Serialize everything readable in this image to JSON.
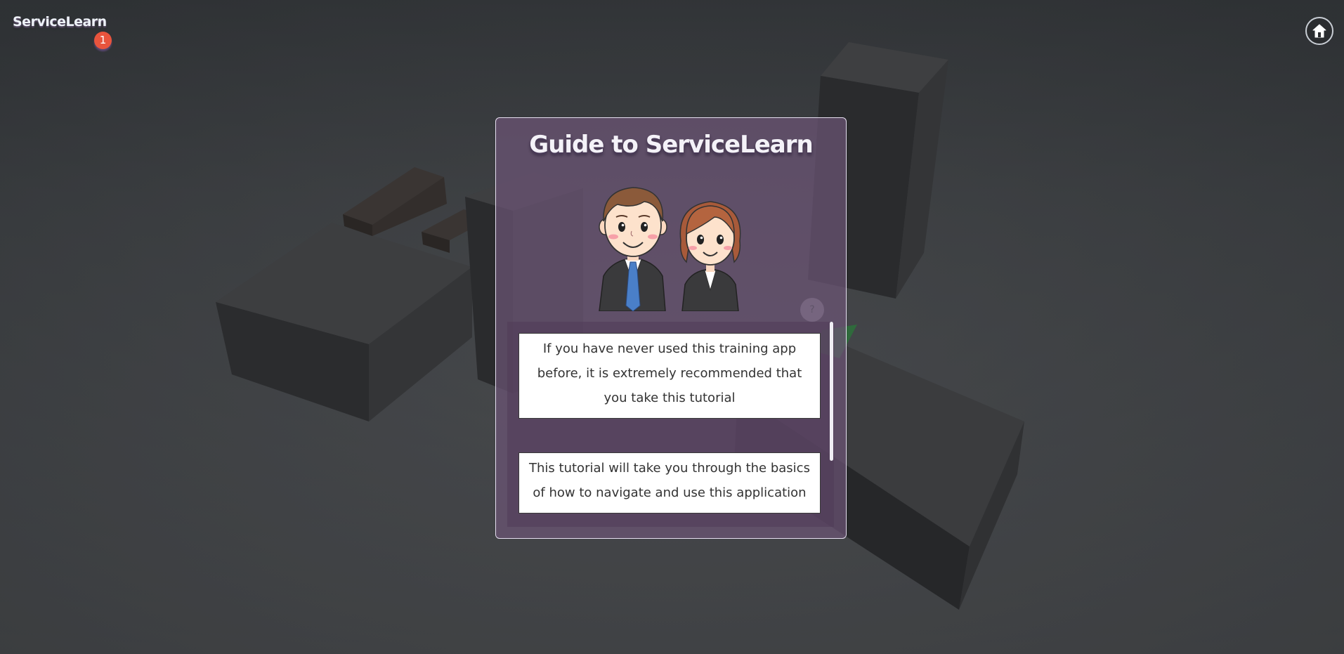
{
  "app": {
    "brand": "ServiceLearn",
    "notification_count": "1"
  },
  "header": {
    "home_icon": "home-icon"
  },
  "modal": {
    "title": "Guide to ServiceLearn",
    "illustration": "two-business-mascots",
    "help_icon": "question-mark-icon",
    "help_text": "?",
    "cards": [
      "If you have never used this training app before, it is extremely recommended that you take this tutorial",
      "This tutorial will take you through the basics of how to navigate and use this application"
    ]
  },
  "colors": {
    "modal_bg": "#6c5476",
    "badge": "#e8543d",
    "card_bg": "#ffffff"
  }
}
